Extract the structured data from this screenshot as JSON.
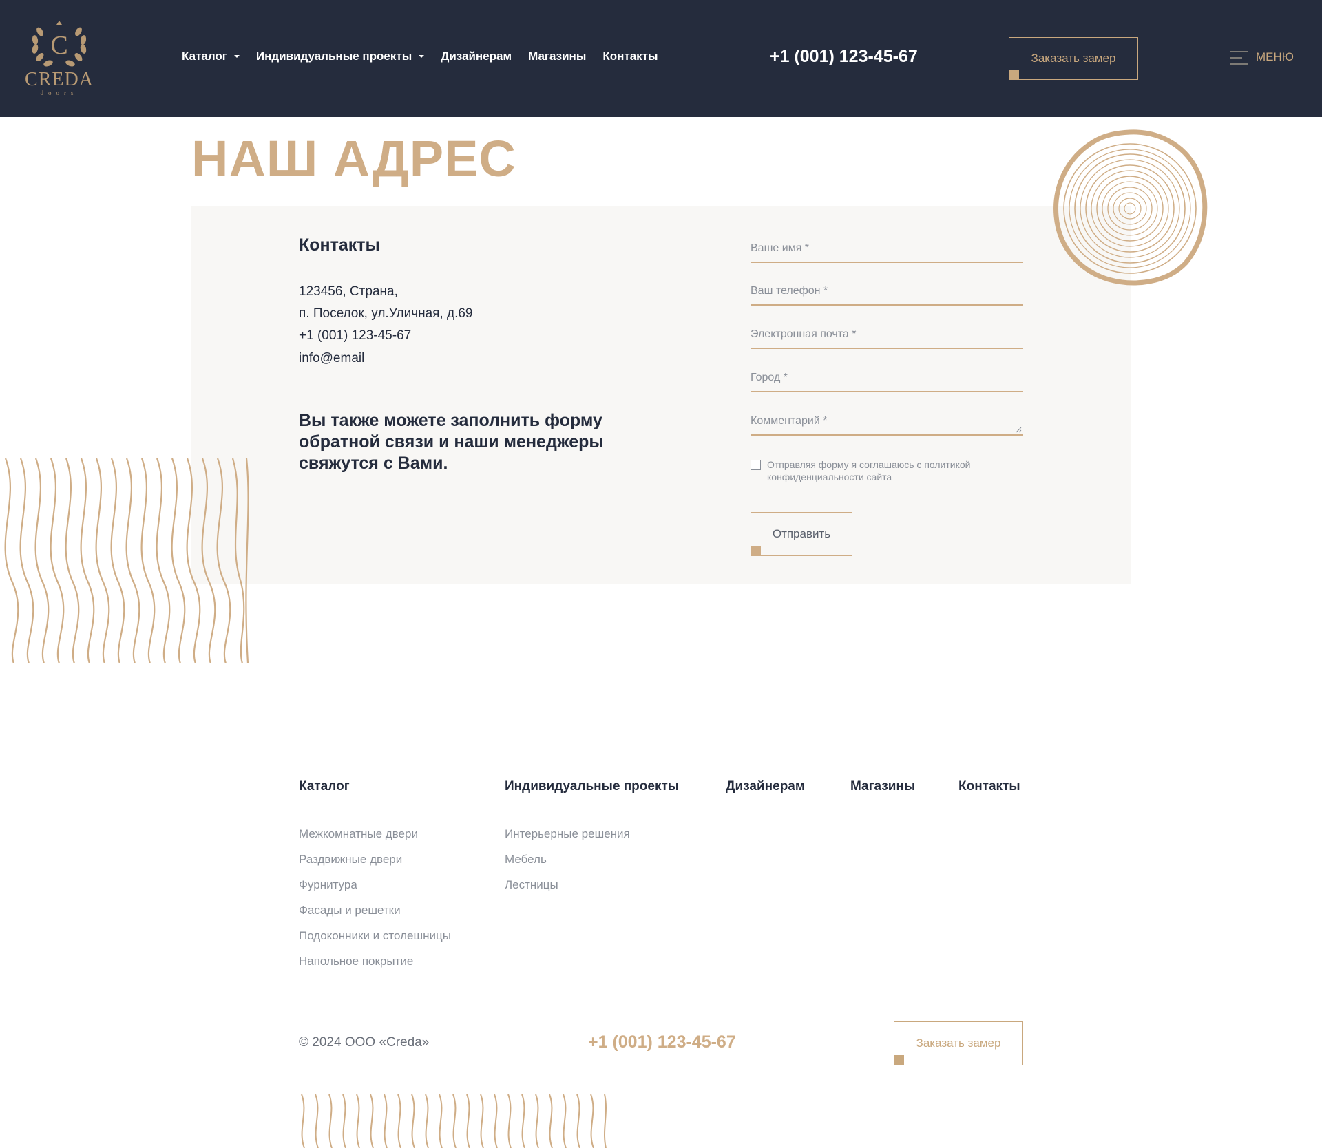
{
  "header": {
    "logo": {
      "name": "CREDA",
      "tagline": "doors"
    },
    "nav": [
      {
        "label": "Каталог",
        "has_dropdown": true
      },
      {
        "label": "Индивидуальные проекты",
        "has_dropdown": true
      },
      {
        "label": "Дизайнерам",
        "has_dropdown": false
      },
      {
        "label": "Магазины",
        "has_dropdown": false
      },
      {
        "label": "Контакты",
        "has_dropdown": false
      }
    ],
    "phone": "+1 (001) 123-45-67",
    "cta_label": "Заказать замер",
    "menu_label": "МЕНЮ"
  },
  "page": {
    "title": "НАШ АДРЕС"
  },
  "contacts": {
    "heading": "Контакты",
    "address_line_1": "123456, Страна,",
    "address_line_2": "п. Поселок, ул.Уличная, д.69",
    "phone": "+1 (001) 123-45-67",
    "email": "info@email",
    "feedback_text": "Вы также можете заполнить форму обратной связи и наши менеджеры свяжутся с Вами."
  },
  "form": {
    "name_placeholder": "Ваше имя *",
    "phone_placeholder": "Ваш телефон *",
    "email_placeholder": "Электронная почта *",
    "city_placeholder": "Город *",
    "comment_placeholder": "Комментарий *",
    "consent_text": "Отправляя форму я соглашаюсь с политикой конфиденциальности сайта",
    "consent_checked": false,
    "submit_label": "Отправить"
  },
  "footer": {
    "columns": [
      {
        "heading": "Каталог",
        "links": [
          "Межкомнатные двери",
          "Раздвижные двери",
          "Фурнитура",
          "Фасады и решетки",
          "Подоконники и столешницы",
          "Напольное покрытие"
        ]
      },
      {
        "heading": "Индивидуальные проекты",
        "links": [
          "Интерьерные решения",
          "Мебель",
          "Лестницы"
        ]
      },
      {
        "heading": "Дизайнерам",
        "links": []
      },
      {
        "heading": "Магазины",
        "links": []
      },
      {
        "heading": "Контакты",
        "links": []
      }
    ],
    "copyright": "© 2024 ООО «Creda»",
    "phone": "+1 (001) 123-45-67",
    "cta_label": "Заказать замер"
  },
  "colors": {
    "header_bg": "#252c3d",
    "accent": "#cfad86",
    "panel_bg": "#f8f7f5",
    "text_dark": "#252c3d",
    "text_muted": "#8a8f98"
  }
}
